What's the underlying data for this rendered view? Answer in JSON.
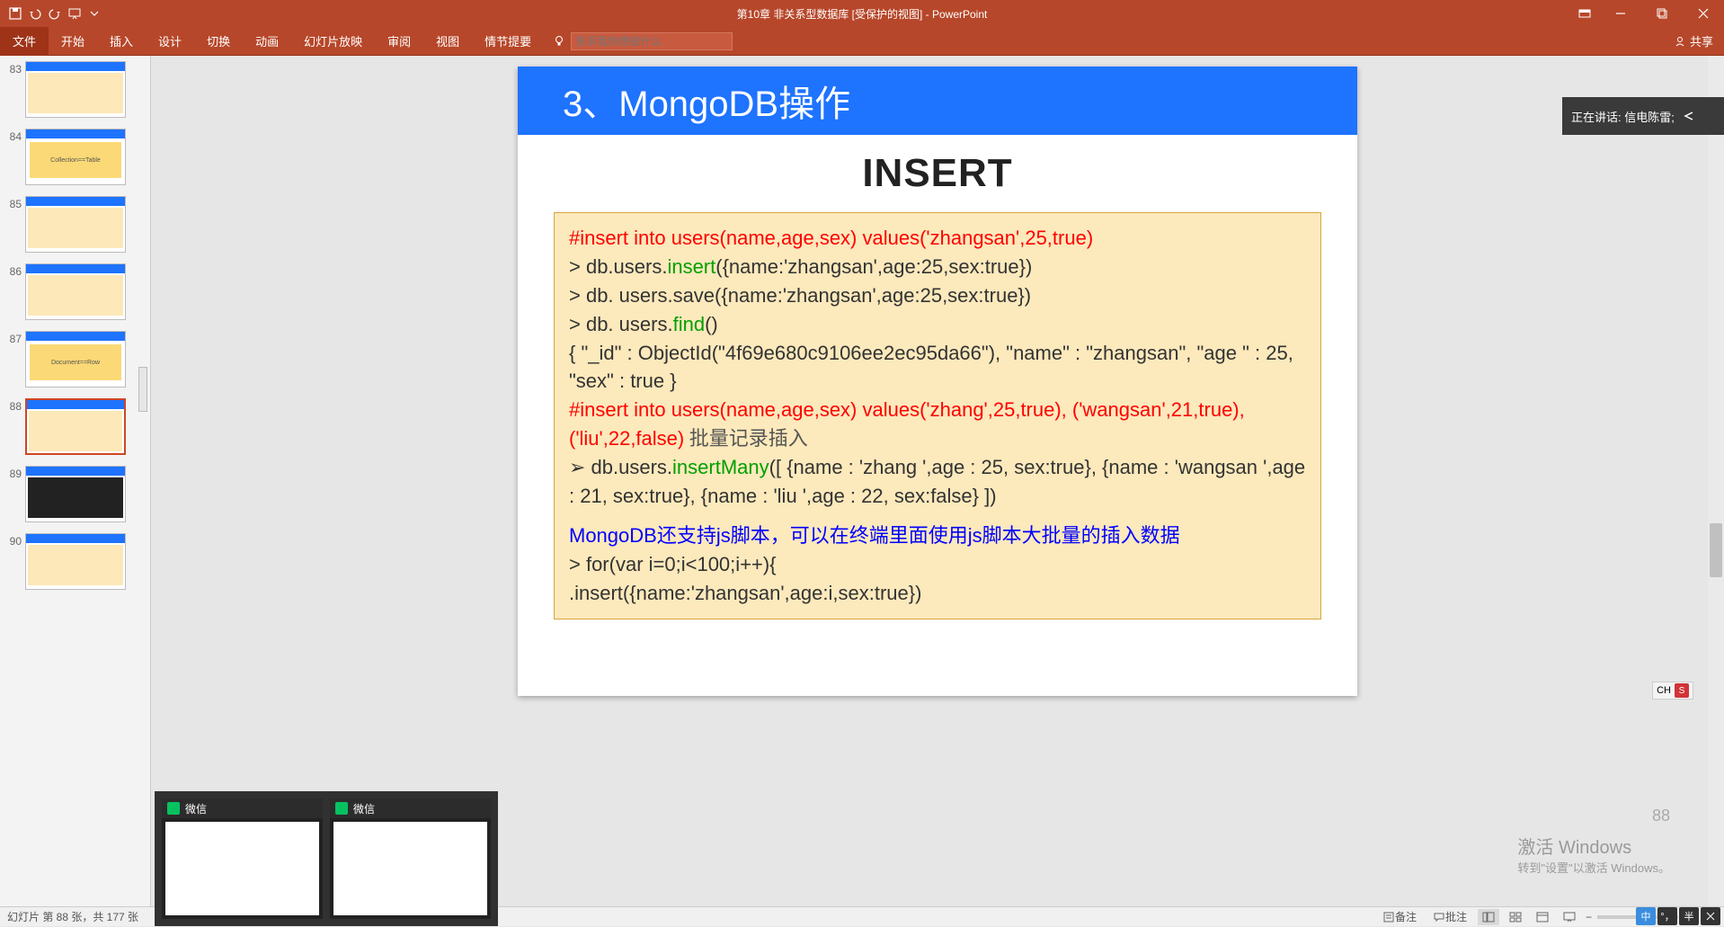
{
  "app": {
    "title_center": "第10章 非关系型数据库 [受保护的视图] - PowerPoint"
  },
  "quick_access": {
    "save": "save",
    "undo": "undo",
    "redo": "redo",
    "start": "start",
    "customize": "customize"
  },
  "ribbon": {
    "file": "文件",
    "tabs": [
      "开始",
      "插入",
      "设计",
      "切换",
      "动画",
      "幻灯片放映",
      "审阅",
      "视图",
      "情节提要"
    ],
    "tellme_placeholder": "告诉我你想做什么",
    "share": "共享"
  },
  "thumbnails": [
    {
      "num": "83",
      "type": "content"
    },
    {
      "num": "84",
      "type": "yellow",
      "label": "Collection==Table"
    },
    {
      "num": "85",
      "type": "content"
    },
    {
      "num": "86",
      "type": "content"
    },
    {
      "num": "87",
      "type": "yellow",
      "label": "Document==Row"
    },
    {
      "num": "88",
      "type": "content",
      "active": true
    },
    {
      "num": "89",
      "type": "dark"
    },
    {
      "num": "90",
      "type": "content"
    }
  ],
  "slide": {
    "title": "3、MongoDB操作",
    "subtitle": "INSERT",
    "code": {
      "l1_comment": "#insert into users(name,age,sex) values('zhangsan',25,true)",
      "l2a": "> db.users.",
      "l2b": "insert",
      "l2c": "({name:'zhangsan',age:25,sex:true})",
      "l3": "> db. users.save({name:'zhangsan',age:25,sex:true})",
      "l4a": "> db. users.",
      "l4b": "find",
      "l4c": "()",
      "l5": "{ \"_id\" : ObjectId(\"4f69e680c9106ee2ec95da66\"), \"name\" : \"zhangsan\", \"age \" : 25, \"sex\" : true }",
      "l6_comment": "#insert into users(name,age,sex) values('zhang',25,true), ('wangsan',21,true),('liu',22,false)",
      "l6_note": "   批量记录插入",
      "l7a": "➢ db.users.",
      "l7b": "insertMany",
      "l7c": "([ {name : 'zhang ',age : 25, sex:true},  {name : 'wangsan ',age : 21, sex:true},  {name : 'liu ',age : 22, sex:false} ])",
      "l8_blue": "MongoDB还支持js脚本，可以在终端里面使用js脚本大批量的插入数据",
      "l9": "> for(var i=0;i<100;i++){",
      "l10a": "            .insert",
      "l10b": "({name:'zhangsan',age:i,sex:true})"
    },
    "page_number": "88"
  },
  "speaker_notification": {
    "label": "正在讲话: 信电陈雷;"
  },
  "status": {
    "left": "幻灯片 第 88 张，共 177 张",
    "notes": "备注",
    "comments": "批注",
    "zoom": "- ——— +",
    "fit": "⊡"
  },
  "activate": {
    "title": "激活 Windows",
    "sub": "转到\"设置\"以激活 Windows。"
  },
  "wechat": {
    "t1": "微信",
    "t2": "微信"
  },
  "lang": {
    "ch": "CH",
    "s": "S"
  },
  "ime": {
    "cn": "中"
  }
}
